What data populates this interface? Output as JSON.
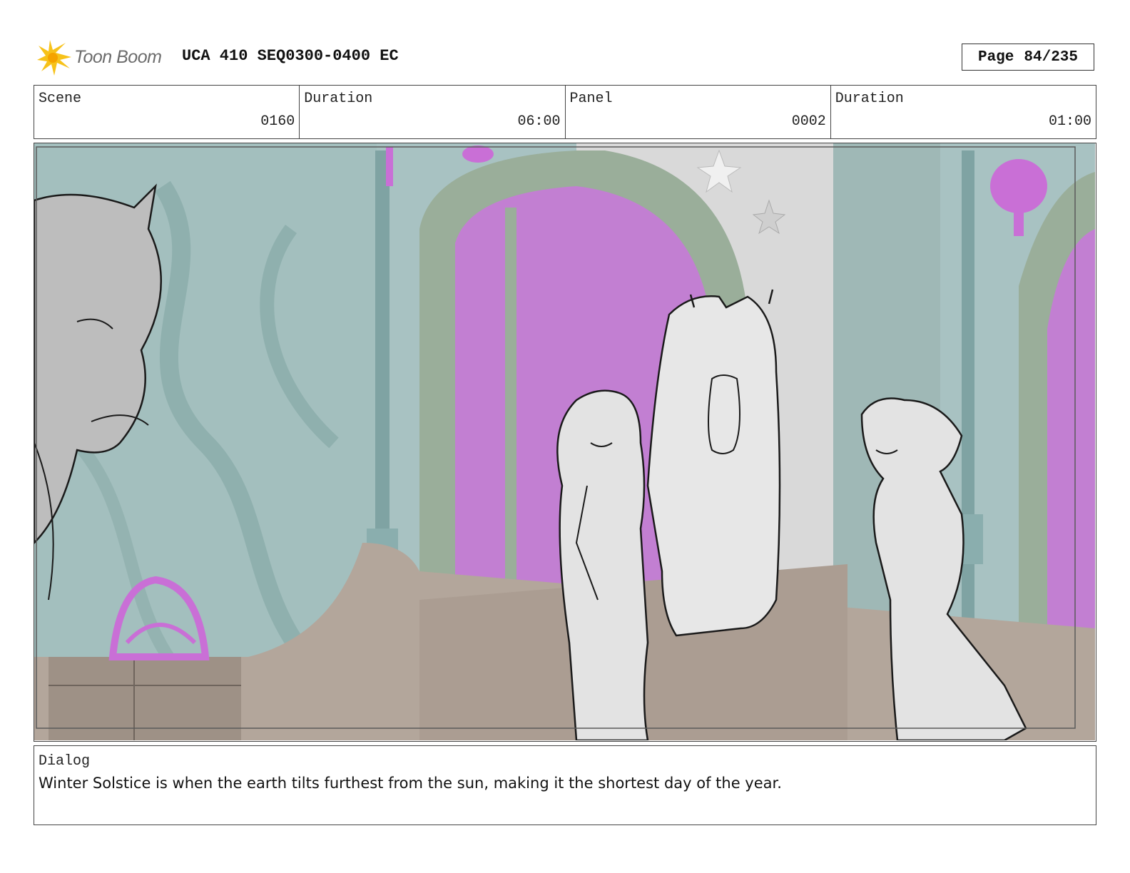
{
  "header": {
    "logo_text": "Toon Boom",
    "title": "UCA 410 SEQ0300-0400 EC",
    "page_label": "Page",
    "page_value": "84/235"
  },
  "info": [
    {
      "label": "Scene",
      "value": "0160"
    },
    {
      "label": "Duration",
      "value": "06:00"
    },
    {
      "label": "Panel",
      "value": "0002"
    },
    {
      "label": "Duration",
      "value": "01:00"
    }
  ],
  "dialog": {
    "label": "Dialog",
    "text": "Winter Solstice is when the earth tilts furthest from the sun, making it the shortest day of the year."
  },
  "colors": {
    "wall_teal": "#9fbcbc",
    "wood_brown": "#b0a49a",
    "arch_green": "#9aae9a",
    "magenta": "#c27fd2",
    "ink": "#1a1a1a"
  }
}
